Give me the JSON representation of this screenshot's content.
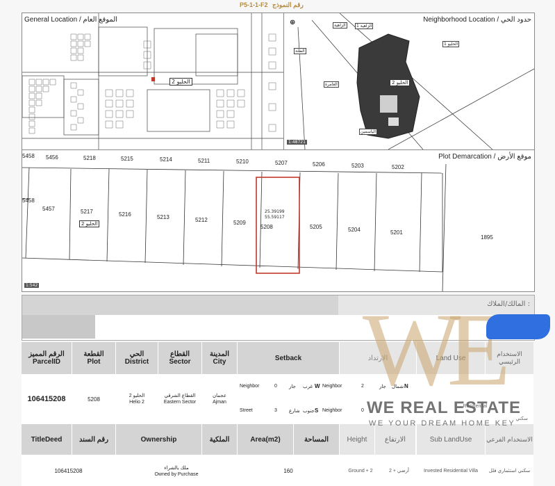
{
  "form_code": "P5-1-1-F2",
  "form_code_ar": "رقم النموذج",
  "general_location": {
    "title": "General Location / الموقع العام",
    "label_helio": "الحليو 2",
    "scale": ""
  },
  "neighborhood_location": {
    "title": "Neighborhood Location / حدود الحي",
    "label_helio": "الحليو 2",
    "scale": "1:48721",
    "marks": [
      "الزاهية 1",
      "الزاهية",
      "الحليو 1",
      "العامرة",
      "الياسمين",
      "الطلة"
    ]
  },
  "plot_demarcation": {
    "title": "Plot Demarcation / موقع الأرض",
    "scale": "1:542",
    "top_row": [
      "5456",
      "5218",
      "5215",
      "5214",
      "5211",
      "5210",
      "5207",
      "5206",
      "5203",
      "5202"
    ],
    "bottom_row": [
      "5457",
      "5217",
      "5216",
      "5213",
      "5212",
      "5209",
      "5208",
      "5205",
      "5204",
      "5201",
      "1895"
    ],
    "edge_labels": [
      "5458",
      "5458"
    ],
    "district_tag": "الحليو 2",
    "coords": [
      "25.39199",
      "55.59117"
    ]
  },
  "owner": {
    "label": "المالك/الملاك :"
  },
  "table": {
    "headers": {
      "parcel_id_ar": "الرقم المميز",
      "parcel_id": "ParcelID",
      "plot_ar": "القطعة",
      "plot": "Plot",
      "district_ar": "الحي",
      "district": "District",
      "sector_ar": "القطاع",
      "sector": "Sector",
      "city_ar": "المدينة",
      "city": "City",
      "setback": "Setback",
      "setback_ar": "الارتداد",
      "land_use": "Land Use",
      "land_use_ar": "الاستخدام الرئيسي"
    },
    "values": {
      "parcel_id": "106415208",
      "plot": "5208",
      "district_ar": "الحليو 2",
      "district": "Helio 2",
      "sector_ar": "القطاع الشرقي",
      "sector": "Eastern Sector",
      "city_ar": "عجمان",
      "city": "Ajman",
      "setback_rows": [
        {
          "type": "Neighbor",
          "value": "0",
          "ar": "جار",
          "dir": "W",
          "dir_ar": "غرب",
          "right_type": "Neighbor",
          "right_value": "2",
          "right_ar": "جار",
          "right_dir": "N",
          "right_dir_ar": "شمال"
        },
        {
          "type": "Street",
          "value": "3",
          "ar": "شارع",
          "dir": "S",
          "dir_ar": "جنوب",
          "right_type": "Neighbor",
          "right_value": "0",
          "right_ar": "",
          "right_dir": "",
          "right_dir_ar": ""
        }
      ],
      "land_use": "Residential",
      "land_use_ar": "سكني"
    },
    "headers2": {
      "title_deed": "TitleDeed",
      "title_deed_ar": "رقم السند",
      "ownership": "Ownership",
      "ownership_ar": "الملكية",
      "area": "Area(m2)",
      "area_ar": "المساحة",
      "height": "Height",
      "height_ar": "الارتفاع",
      "sub_land_use": "Sub LandUse",
      "sub_land_use_ar": "الاستخدام الفرعي"
    },
    "values2": {
      "title_deed": "106415208",
      "ownership_ar": "ملك بالشراء",
      "ownership": "Owned by Purchase",
      "area": "160",
      "height": "Ground + 2",
      "height_ar": "أرضي + 2",
      "sub_land_use": "Invested Residential Villa",
      "sub_land_use_ar": "سكني استثماري فلل"
    }
  },
  "watermark": {
    "logo": "WE",
    "name": "WE REAL ESTATE",
    "tagline": "WE YOUR DREAM HOME KEY"
  },
  "colors": {
    "plot_highlight": "#c0392b",
    "watermark_gold": "#c9a46b",
    "accent_blue": "#2f6fe0",
    "header_grey": "#d4d4d4"
  }
}
